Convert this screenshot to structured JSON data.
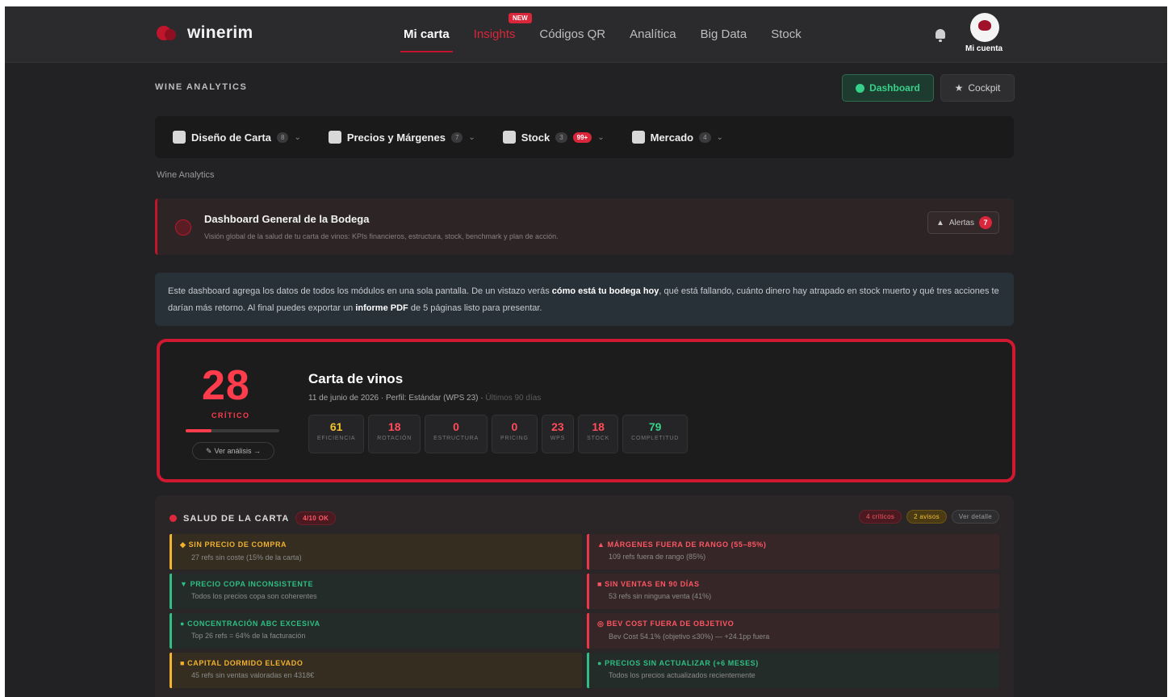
{
  "app": {
    "name": "winerim"
  },
  "nav": {
    "items": [
      {
        "label": "Mi carta",
        "state": "active"
      },
      {
        "label": "Insights",
        "state": "red",
        "badge": "NEW"
      },
      {
        "label": "Códigos QR",
        "state": "normal"
      },
      {
        "label": "Analítica",
        "state": "normal"
      },
      {
        "label": "Big Data",
        "state": "normal"
      },
      {
        "label": "Stock",
        "state": "normal"
      }
    ],
    "account_label": "Mi cuenta"
  },
  "page": {
    "section_label": "WINE ANALYTICS",
    "dashboard_button": "Dashboard",
    "cockpit_button": "Cockpit",
    "breadcrumb": "Wine Analytics"
  },
  "subnav": [
    {
      "label": "Diseño de Carta",
      "count": "8"
    },
    {
      "label": "Precios y Márgenes",
      "count": "7"
    },
    {
      "label": "Stock",
      "count": "3",
      "hot": "99+"
    },
    {
      "label": "Mercado",
      "count": "4"
    }
  ],
  "alert_card": {
    "title": "Dashboard General de la Bodega",
    "subtitle": "Visión global de la salud de tu carta de vinos: KPIs financieros, estructura, stock, benchmark y plan de acción.",
    "alerts_label": "Alertas",
    "alerts_count": "7"
  },
  "info": {
    "p1": "Este dashboard agrega los datos de todos los módulos en una sola pantalla. De un vistazo verás ",
    "b1": "cómo está tu bodega hoy",
    "p2": ", qué está fallando, cuánto dinero hay atrapado en stock muerto y qué tres acciones te darían más retorno. Al final puedes exportar un ",
    "b2": "informe PDF",
    "p3": " de 5 páginas listo para presentar."
  },
  "score": {
    "value": "28",
    "level": "CRÍTICO",
    "progress_percent": 28,
    "analysis_button": "Ver análisis →",
    "title": "Carta de vinos",
    "subtitle": "11 de junio de 2026 · Perfil: Estándar (WPS 23) · ",
    "subtitle_muted": "Últimos 90 días",
    "metrics": [
      {
        "value": "61",
        "label": "EFICIENCIA",
        "color": "#f2c12e"
      },
      {
        "value": "18",
        "label": "ROTACIÓN",
        "color": "#ff4b5a"
      },
      {
        "value": "0",
        "label": "ESTRUCTURA",
        "color": "#ff4b5a"
      },
      {
        "value": "0",
        "label": "PRICING",
        "color": "#ff4b5a"
      },
      {
        "value": "23",
        "label": "WPS",
        "color": "#ff4b5a"
      },
      {
        "value": "18",
        "label": "STOCK",
        "color": "#ff4b5a"
      },
      {
        "value": "79",
        "label": "COMPLETITUD",
        "color": "#37d08a"
      }
    ]
  },
  "health": {
    "title": "SALUD DE LA CARTA",
    "status_pill": "4/10 OK",
    "pills": [
      "4 críticos",
      "2 avisos",
      "Ver detalle"
    ],
    "items": [
      {
        "icon": "tag-icon",
        "icon_char": "◆",
        "title": "SIN PRECIO DE COMPRA",
        "desc": "27 refs sin coste (15% de la carta)",
        "tone": "amber"
      },
      {
        "icon": "warning-icon",
        "icon_char": "▲",
        "title": "MÁRGENES FUERA DE RANGO (55–85%)",
        "desc": "109 refs fuera de rango (85%)",
        "tone": "red"
      },
      {
        "icon": "glass-icon",
        "icon_char": "▼",
        "title": "PRECIO COPA INCONSISTENTE",
        "desc": "Todos los precios copa son coherentes",
        "tone": "green"
      },
      {
        "icon": "calendar-icon",
        "icon_char": "■",
        "title": "SIN VENTAS EN 90 DÍAS",
        "desc": "53 refs sin ninguna venta (41%)",
        "tone": "red"
      },
      {
        "icon": "check-circle-icon",
        "icon_char": "●",
        "title": "CONCENTRACIÓN ABC EXCESIVA",
        "desc": "Top 26 refs = 64% de la facturación",
        "tone": "green"
      },
      {
        "icon": "target-icon",
        "icon_char": "◎",
        "title": "BEV COST FUERA DE OBJETIVO",
        "desc": "Bev Cost 54.1% (objetivo ≤30%) — +24.1pp fuera",
        "tone": "red"
      },
      {
        "icon": "box-icon",
        "icon_char": "■",
        "title": "CAPITAL DORMIDO ELEVADO",
        "desc": "45 refs sin ventas valoradas en 4318€",
        "tone": "amber"
      },
      {
        "icon": "check-circle-icon",
        "icon_char": "●",
        "title": "PRECIOS SIN ACTUALIZAR (+6 MESES)",
        "desc": "Todos los precios actualizados recientemente",
        "tone": "green"
      }
    ]
  }
}
